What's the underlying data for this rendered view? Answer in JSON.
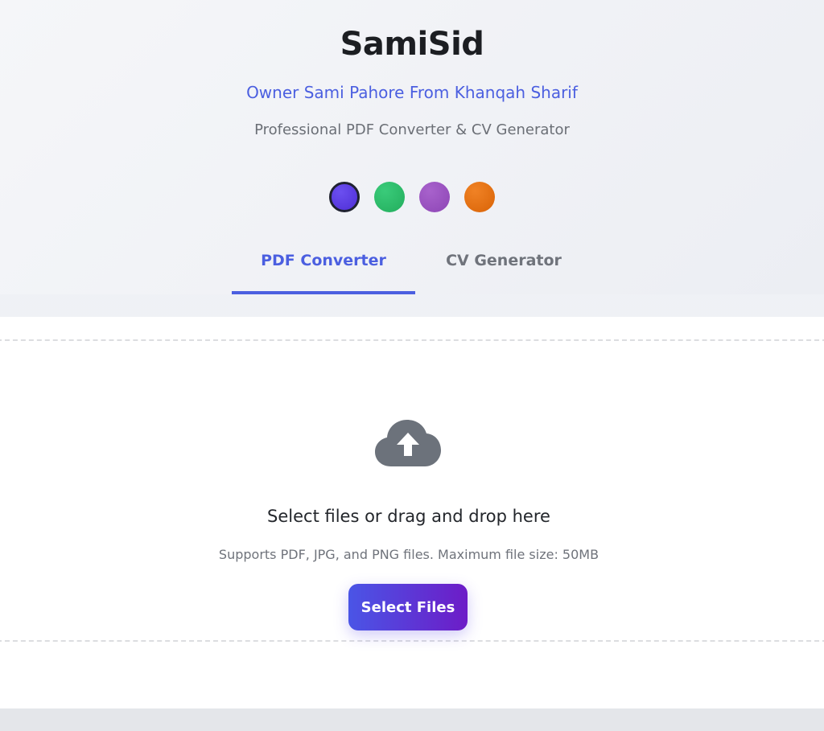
{
  "header": {
    "brand": "SamiSid",
    "owner": "Owner Sami Pahore From Khanqah Sharif",
    "tagline": "Professional PDF Converter & CV Generator"
  },
  "theme_swatches": [
    {
      "name": "indigo",
      "color": "#5a3fe0",
      "selected": true
    },
    {
      "name": "green",
      "color": "#2bbd6a",
      "selected": false
    },
    {
      "name": "purple",
      "color": "#9b50c0",
      "selected": false
    },
    {
      "name": "orange",
      "color": "#e6720f",
      "selected": false
    }
  ],
  "tabs": [
    {
      "label": "PDF Converter",
      "active": true
    },
    {
      "label": "CV Generator",
      "active": false
    }
  ],
  "upload": {
    "icon": "cloud-upload-icon",
    "title": "Select files or drag and drop here",
    "hint": "Supports PDF, JPG, and PNG files. Maximum file size: 50MB",
    "button_label": "Select Files"
  },
  "colors": {
    "accent": "#4b5fe0",
    "button_start": "#4a55e6",
    "button_end": "#6d1cc7"
  }
}
